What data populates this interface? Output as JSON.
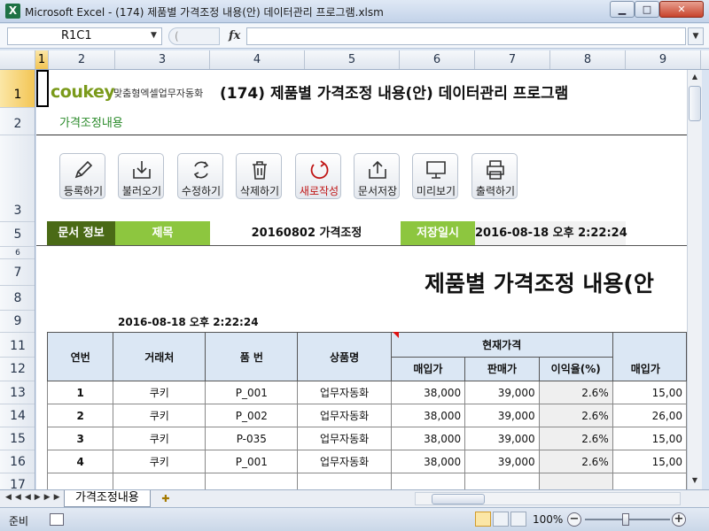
{
  "window": {
    "title": "Microsoft Excel - (174) 제품별 가격조정 내용(안) 데이터관리 프로그램.xlsm",
    "app_icon": "X",
    "min_icon": "minimize-icon",
    "max_icon": "maximize-icon",
    "close_icon": "close-icon"
  },
  "formula_bar": {
    "name_box": "R1C1",
    "fx_label": "fx",
    "formula": ""
  },
  "columns": [
    "1",
    "2",
    "3",
    "4",
    "5",
    "6",
    "7",
    "8",
    "9"
  ],
  "rows": [
    "1",
    "2",
    "3",
    "5",
    "6",
    "7",
    "8",
    "9",
    "11",
    "12",
    "13",
    "14",
    "15",
    "16",
    "17"
  ],
  "header": {
    "logo": "coukey",
    "logo_sub": "맞춤형엑셀업무자동화",
    "title": "(174) 제품별 가격조정 내용(안) 데이터관리 프로그램",
    "subtitle": "가격조정내용"
  },
  "toolbar": {
    "buttons": [
      {
        "label": "등록하기",
        "icon": "pencil-icon"
      },
      {
        "label": "불러오기",
        "icon": "import-tray-icon"
      },
      {
        "label": "수정하기",
        "icon": "refresh-icon"
      },
      {
        "label": "삭제하기",
        "icon": "trash-icon"
      },
      {
        "label": "새로작성",
        "icon": "new-document-icon"
      },
      {
        "label": "문서저장",
        "icon": "save-tray-icon"
      },
      {
        "label": "미리보기",
        "icon": "monitor-icon"
      },
      {
        "label": "출력하기",
        "icon": "printer-icon"
      }
    ]
  },
  "doc_info": {
    "label": "문서 정보",
    "subject_label": "제목",
    "subject": "20160802 가격조정",
    "saved_label": "저장일시",
    "saved": "2016-08-18 오후 2:22:24"
  },
  "document": {
    "title": "제품별 가격조정 내용(안",
    "date": "2016-08-18 오후 2:22:24"
  },
  "table": {
    "headers": {
      "no": "연번",
      "vendor": "거래처",
      "part": "품 번",
      "product": "상품명",
      "current": "현재가격",
      "purchase": "매입가",
      "sale": "판매가",
      "margin": "이익율(%)",
      "purchase2": "매입가"
    },
    "rows": [
      {
        "no": "1",
        "vendor": "쿠키",
        "part": "P_001",
        "product": "업무자동화",
        "purchase": "38,000",
        "sale": "39,000",
        "margin": "2.6%",
        "purchase2": "15,00"
      },
      {
        "no": "2",
        "vendor": "쿠키",
        "part": "P_002",
        "product": "업무자동화",
        "purchase": "38,000",
        "sale": "39,000",
        "margin": "2.6%",
        "purchase2": "26,00"
      },
      {
        "no": "3",
        "vendor": "쿠키",
        "part": "P-035",
        "product": "업무자동화",
        "purchase": "38,000",
        "sale": "39,000",
        "margin": "2.6%",
        "purchase2": "15,00"
      },
      {
        "no": "4",
        "vendor": "쿠키",
        "part": "P_001",
        "product": "업무자동화",
        "purchase": "38,000",
        "sale": "39,000",
        "margin": "2.6%",
        "purchase2": "15,00"
      }
    ]
  },
  "sheet_tabs": {
    "active": "가격조정내용"
  },
  "status": {
    "ready": "준비",
    "zoom": "100%",
    "zoom_out": "−",
    "zoom_in": "+"
  }
}
